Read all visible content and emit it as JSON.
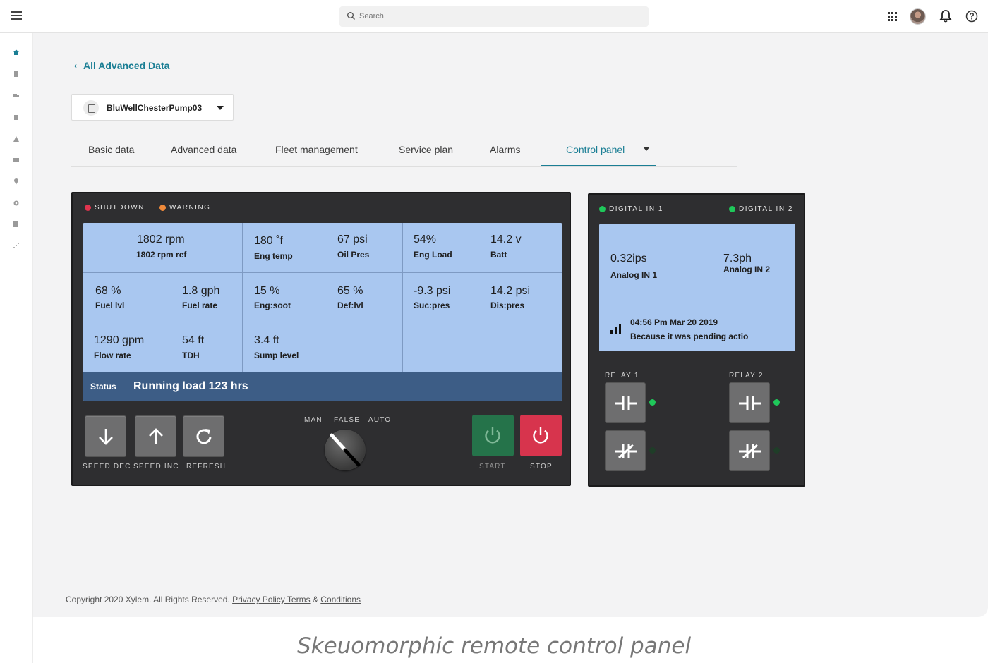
{
  "topbar": {
    "search_placeholder": "Search"
  },
  "sidebar": {
    "items": [
      "home-icon",
      "document-icon",
      "truck-icon",
      "clipboard-icon",
      "alert-icon",
      "map-icon",
      "location-icon",
      "settings-icon",
      "report-icon",
      "analytics-icon"
    ]
  },
  "breadcrumb": {
    "back_label": "All Advanced Data"
  },
  "device_select": {
    "selected": "BluWellChesterPump03"
  },
  "tabs": [
    {
      "label": "Basic data"
    },
    {
      "label": "Advanced data"
    },
    {
      "label": "Fleet management"
    },
    {
      "label": "Service plan"
    },
    {
      "label": "Alarms"
    },
    {
      "label": "Control panel"
    }
  ],
  "control_panel": {
    "indicators": [
      {
        "label": "SHUTDOWN",
        "color": "#e0344e"
      },
      {
        "label": "WARNING",
        "color": "#f08a3a"
      }
    ],
    "readings": {
      "rpm": {
        "value": "1802 rpm",
        "label": "1802 rpm ref"
      },
      "eng_temp": {
        "value": "180 ˚f",
        "label": "Eng temp"
      },
      "oil_pres": {
        "value": "67 psi",
        "label": "Oil Pres"
      },
      "eng_load": {
        "value": "54%",
        "label": "Eng Load"
      },
      "batt": {
        "value": "14.2 v",
        "label": "Batt"
      },
      "fuel_lvl": {
        "value": "68 %",
        "label": "Fuel lvl"
      },
      "fuel_rate": {
        "value": "1.8 gph",
        "label": "Fuel rate"
      },
      "eng_soot": {
        "value": "15 %",
        "label": "Eng:soot"
      },
      "def_lvl": {
        "value": "65 %",
        "label": "Def:lvl"
      },
      "suc_pres": {
        "value": "-9.3 psi",
        "label": "Suc:pres"
      },
      "dis_pres": {
        "value": "14.2 psi",
        "label": "Dis:pres"
      },
      "flow_rate": {
        "value": "1290 gpm",
        "label": "Flow rate"
      },
      "tdh": {
        "value": "54 ft",
        "label": "TDH"
      },
      "sump_level": {
        "value": "3.4 ft",
        "label": "Sump level"
      }
    },
    "status": {
      "key": "Status",
      "value": "Running load 123 hrs"
    },
    "buttons": {
      "speed_dec": "SPEED DEC",
      "speed_inc": "SPEED INC",
      "refresh": "REFRESH",
      "start": "START",
      "stop": "STOP"
    },
    "mode_switch": {
      "options": [
        "MAN",
        "FALSE",
        "AUTO"
      ]
    },
    "colors": {
      "start": "#25734a",
      "stop": "#d7344d"
    }
  },
  "digital_panel": {
    "inputs": [
      {
        "label": "DIGITAL IN 1",
        "color": "#1fc85a"
      },
      {
        "label": "DIGITAL IN 2",
        "color": "#1fc85a"
      }
    ],
    "analog": [
      {
        "value": "0.32ips",
        "label": "Analog IN 1"
      },
      {
        "value": "7.3ph",
        "label": "Analog IN 2"
      }
    ],
    "event": {
      "timestamp": "04:56 Pm Mar 20 2019",
      "message": "Because it was pending actio"
    },
    "relays": [
      {
        "label": "RELAY 1"
      },
      {
        "label": "RELAY 2"
      }
    ]
  },
  "footer": {
    "copyright": "Copyright 2020 Xylem. All Rights Reserved.",
    "privacy_link": "Privacy Policy Terms",
    "amp": "&",
    "conditions_link": "Conditions"
  },
  "caption": "Skeuomorphic remote control panel"
}
